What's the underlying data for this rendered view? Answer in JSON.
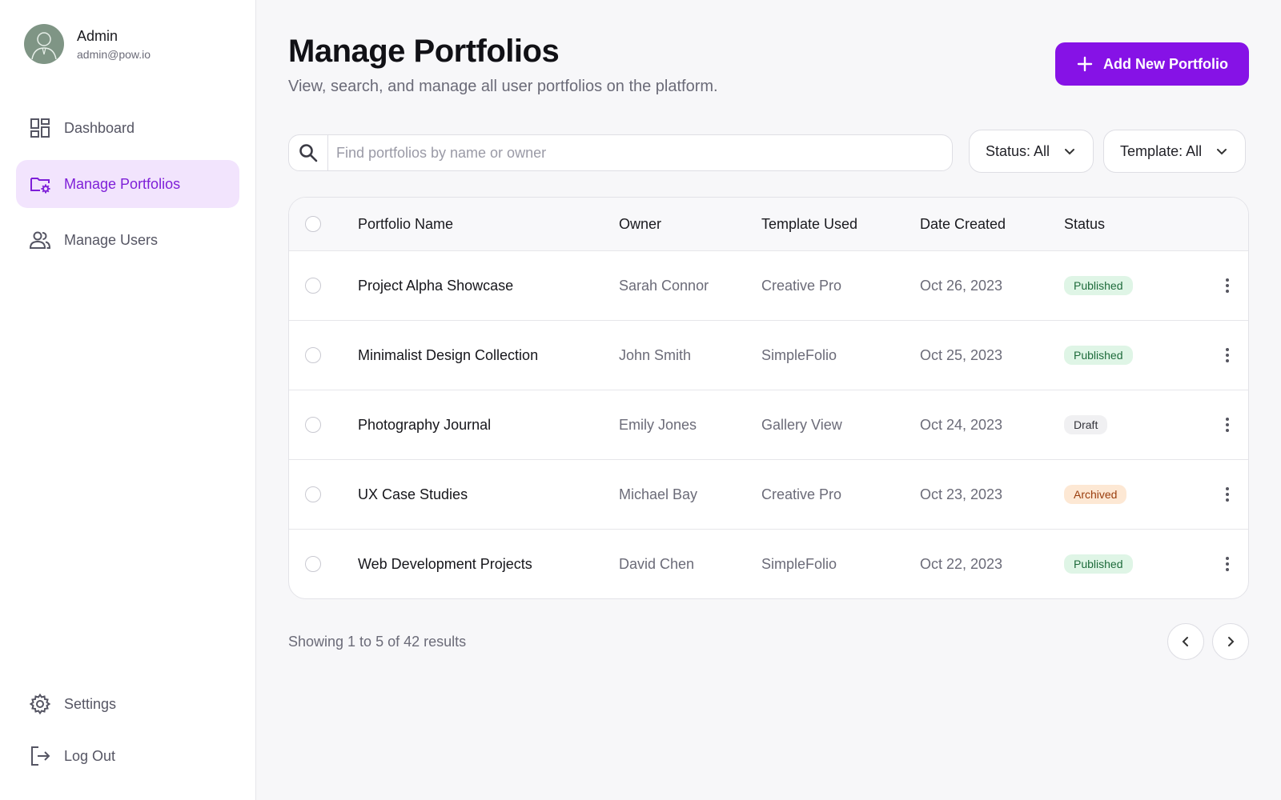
{
  "user": {
    "name": "Admin",
    "email": "admin@pow.io"
  },
  "sidebar": {
    "items": [
      {
        "label": "Dashboard",
        "icon": "dashboard-icon",
        "active": false
      },
      {
        "label": "Manage Portfolios",
        "icon": "folder-settings-icon",
        "active": true
      },
      {
        "label": "Manage Users",
        "icon": "users-icon",
        "active": false
      }
    ],
    "bottom": [
      {
        "label": "Settings",
        "icon": "gear-icon"
      },
      {
        "label": "Log Out",
        "icon": "logout-icon"
      }
    ]
  },
  "header": {
    "title": "Manage Portfolios",
    "subtitle": "View, search, and manage all user portfolios on the platform.",
    "add_button": "Add New Portfolio"
  },
  "search": {
    "placeholder": "Find portfolios by name or owner",
    "value": ""
  },
  "filters": {
    "status": "Status: All",
    "template": "Template: All"
  },
  "table": {
    "columns": [
      "Portfolio Name",
      "Owner",
      "Template Used",
      "Date Created",
      "Status"
    ],
    "rows": [
      {
        "name": "Project Alpha Showcase",
        "owner": "Sarah Connor",
        "template": "Creative Pro",
        "date": "Oct 26, 2023",
        "status": "Published"
      },
      {
        "name": "Minimalist Design Collection",
        "owner": "John Smith",
        "template": "SimpleFolio",
        "date": "Oct 25, 2023",
        "status": "Published"
      },
      {
        "name": "Photography Journal",
        "owner": "Emily Jones",
        "template": "Gallery View",
        "date": "Oct 24, 2023",
        "status": "Draft"
      },
      {
        "name": "UX Case Studies",
        "owner": "Michael Bay",
        "template": "Creative Pro",
        "date": "Oct 23, 2023",
        "status": "Archived"
      },
      {
        "name": "Web Development Projects",
        "owner": "David Chen",
        "template": "SimpleFolio",
        "date": "Oct 22, 2023",
        "status": "Published"
      }
    ]
  },
  "pagination": {
    "summary": "Showing 1 to 5 of 42 results"
  },
  "colors": {
    "accent": "#8612e6",
    "active_bg": "#f2e4fd",
    "published": "#dff5e6",
    "archived": "#fde8d4",
    "draft": "#f0f0f2"
  }
}
